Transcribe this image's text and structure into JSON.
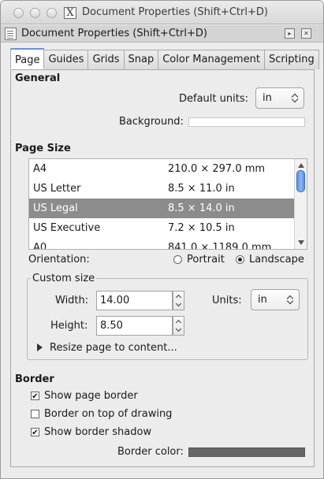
{
  "window": {
    "title": "Document Properties (Shift+Ctrl+D)",
    "x11_glyph": "X"
  },
  "dock": {
    "title": "Document Properties (Shift+Ctrl+D)",
    "float_glyph": "▸",
    "close_glyph": "✕"
  },
  "tabs": [
    {
      "label": "Page",
      "active": true
    },
    {
      "label": "Guides"
    },
    {
      "label": "Grids"
    },
    {
      "label": "Snap"
    },
    {
      "label": "Color Management"
    },
    {
      "label": "Scripting"
    }
  ],
  "general": {
    "heading": "General",
    "default_units_label": "Default units:",
    "default_units_value": "in",
    "background_label": "Background:",
    "background_color": "#ffffff"
  },
  "page_size": {
    "heading": "Page Size",
    "rows": [
      {
        "name": "A4",
        "size": "210.0 × 297.0 mm"
      },
      {
        "name": "US Letter",
        "size": "8.5 × 11.0 in"
      },
      {
        "name": "US Legal",
        "size": "8.5 × 14.0 in",
        "selected": true
      },
      {
        "name": "US Executive",
        "size": "7.2 × 10.5 in"
      },
      {
        "name": "A0",
        "size": "841.0 × 1189.0 mm"
      }
    ]
  },
  "orientation": {
    "label": "Orientation:",
    "portrait": "Portrait",
    "landscape": "Landscape",
    "selected": "Landscape"
  },
  "custom_size": {
    "title": "Custom size",
    "width_label": "Width:",
    "width_value": "14.00",
    "height_label": "Height:",
    "height_value": "8.50",
    "units_label": "Units:",
    "units_value": "in",
    "resize_label": "Resize page to content..."
  },
  "border": {
    "heading": "Border",
    "show_page_border": "Show page border",
    "show_page_border_checked": true,
    "border_on_top": "Border on top of drawing",
    "border_on_top_checked": false,
    "show_border_shadow": "Show border shadow",
    "show_border_shadow_checked": true,
    "border_color_label": "Border color:",
    "border_color": "#666666"
  }
}
